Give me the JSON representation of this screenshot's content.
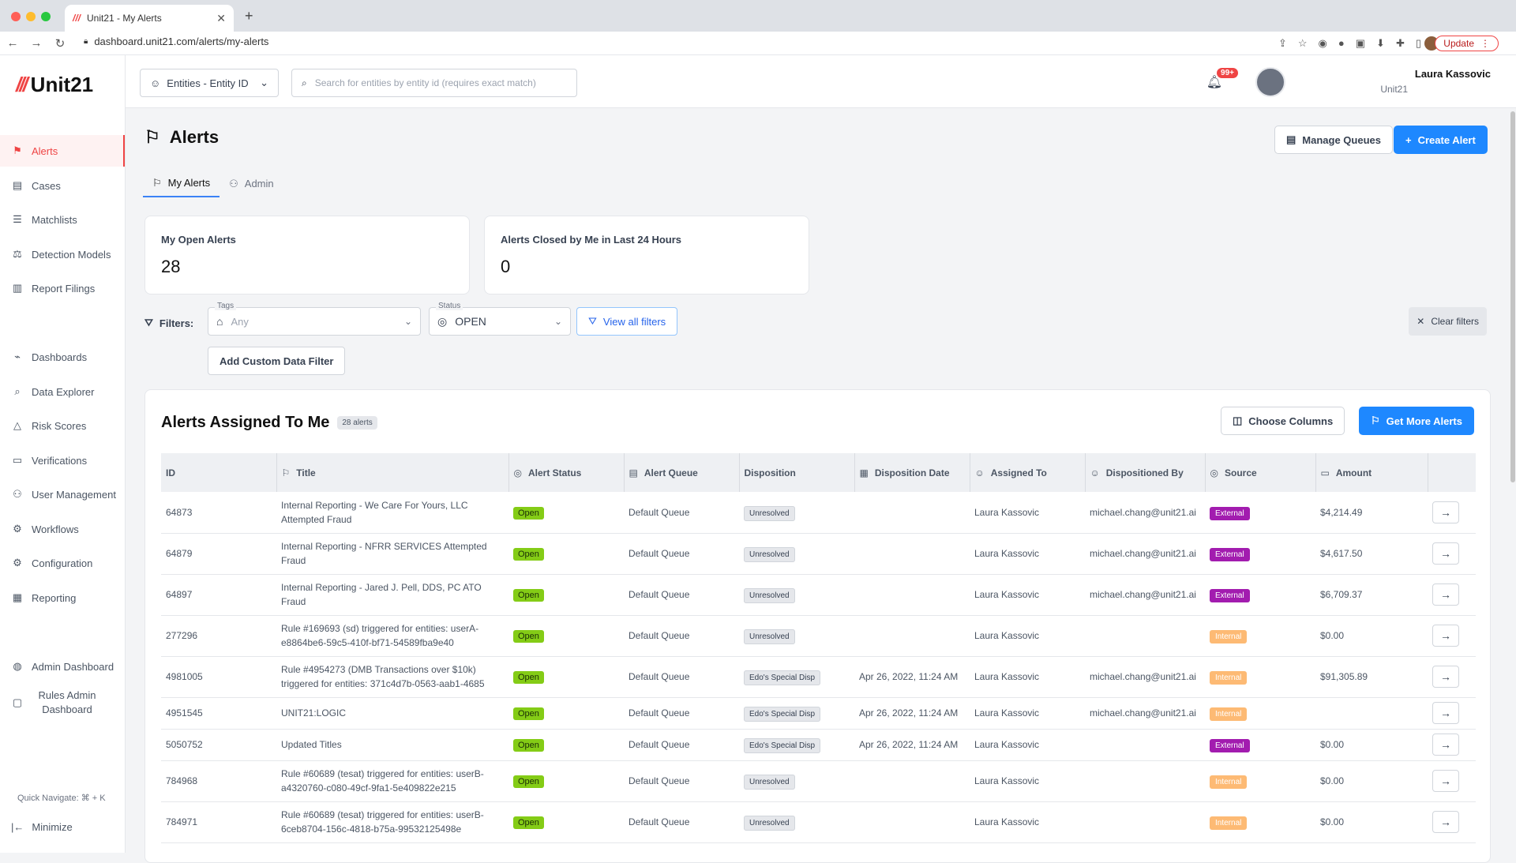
{
  "browser": {
    "tab_title": "Unit21 - My Alerts",
    "url": "dashboard.unit21.com/alerts/my-alerts",
    "update_label": "Update"
  },
  "app": {
    "brand": "Unit21",
    "search_placeholder": "Search for entities by entity id (requires exact match)",
    "entity_selector": "Entities - Entity ID",
    "notifications_badge": "99+",
    "user_name": "Laura Kassovic",
    "user_org": "Unit21"
  },
  "sidebar": {
    "items": [
      {
        "label": "Alerts",
        "icon": "flag-icon"
      },
      {
        "label": "Cases",
        "icon": "briefcase-icon"
      },
      {
        "label": "Matchlists",
        "icon": "user-list-icon"
      },
      {
        "label": "Detection Models",
        "icon": "scale-icon"
      },
      {
        "label": "Report Filings",
        "icon": "building-icon"
      },
      {
        "label": "Dashboards",
        "icon": "chart-icon"
      },
      {
        "label": "Data Explorer",
        "icon": "search-data-icon"
      },
      {
        "label": "Risk Scores",
        "icon": "warning-icon"
      },
      {
        "label": "Verifications",
        "icon": "id-card-icon"
      },
      {
        "label": "User Management",
        "icon": "users-icon"
      },
      {
        "label": "Workflows",
        "icon": "workflow-icon"
      },
      {
        "label": "Configuration",
        "icon": "gear-icon"
      },
      {
        "label": "Reporting",
        "icon": "report-icon"
      },
      {
        "label": "Admin Dashboard",
        "icon": "globe-icon"
      },
      {
        "label": "Rules Admin Dashboard",
        "icon": "clipboard-icon"
      }
    ],
    "quick_navigate": "Quick Navigate: ⌘ + K",
    "minimize": "Minimize"
  },
  "page": {
    "title": "Alerts",
    "manage_queues": "Manage Queues",
    "create_alert": "Create Alert",
    "tabs": [
      "My Alerts",
      "Admin"
    ],
    "stats": [
      {
        "label": "My Open Alerts",
        "value": "28"
      },
      {
        "label": "Alerts Closed by Me in Last 24 Hours",
        "value": "0"
      }
    ],
    "filters": {
      "label": "Filters:",
      "tags_caption": "Tags",
      "tags_value": "Any",
      "status_caption": "Status",
      "status_value": "OPEN",
      "view_all": "View all filters",
      "clear": "Clear filters",
      "add_custom": "Add Custom Data Filter"
    }
  },
  "table": {
    "title": "Alerts Assigned To Me",
    "count": "28 alerts",
    "choose_columns": "Choose Columns",
    "get_more": "Get More Alerts",
    "headers": [
      "ID",
      "Title",
      "Alert Status",
      "Alert Queue",
      "Disposition",
      "Disposition Date",
      "Assigned To",
      "Dispositioned By",
      "Source",
      "Amount"
    ],
    "rows": [
      {
        "id": "64873",
        "title": "Internal Reporting - We Care For Yours, LLC Attempted Fraud",
        "status": "Open",
        "queue": "Default Queue",
        "disposition": "Unresolved",
        "date": "",
        "assigned": "Laura Kassovic",
        "by": "michael.chang@unit21.ai",
        "source": "External",
        "amount": "$4,214.49"
      },
      {
        "id": "64879",
        "title": "Internal Reporting - NFRR SERVICES Attempted Fraud",
        "status": "Open",
        "queue": "Default Queue",
        "disposition": "Unresolved",
        "date": "",
        "assigned": "Laura Kassovic",
        "by": "michael.chang@unit21.ai",
        "source": "External",
        "amount": "$4,617.50"
      },
      {
        "id": "64897",
        "title": "Internal Reporting - Jared J. Pell, DDS, PC ATO Fraud",
        "status": "Open",
        "queue": "Default Queue",
        "disposition": "Unresolved",
        "date": "",
        "assigned": "Laura Kassovic",
        "by": "michael.chang@unit21.ai",
        "source": "External",
        "amount": "$6,709.37"
      },
      {
        "id": "277296",
        "title": "Rule #169693 (sd) triggered for entities: userA-e8864be6-59c5-410f-bf71-54589fba9e40",
        "status": "Open",
        "queue": "Default Queue",
        "disposition": "Unresolved",
        "date": "",
        "assigned": "Laura Kassovic",
        "by": "",
        "source": "Internal",
        "amount": "$0.00"
      },
      {
        "id": "4981005",
        "title": "Rule #4954273 (DMB Transactions over $10k) triggered for entities: 371c4d7b-0563-aab1-4685",
        "status": "Open",
        "queue": "Default Queue",
        "disposition": "Edo's Special Disp",
        "date": "Apr 26, 2022, 11:24 AM",
        "assigned": "Laura Kassovic",
        "by": "michael.chang@unit21.ai",
        "source": "Internal",
        "amount": "$91,305.89"
      },
      {
        "id": "4951545",
        "title": "UNIT21:LOGIC",
        "status": "Open",
        "queue": "Default Queue",
        "disposition": "Edo's Special Disp",
        "date": "Apr 26, 2022, 11:24 AM",
        "assigned": "Laura Kassovic",
        "by": "michael.chang@unit21.ai",
        "source": "Internal",
        "amount": ""
      },
      {
        "id": "5050752",
        "title": "Updated Titles",
        "status": "Open",
        "queue": "Default Queue",
        "disposition": "Edo's Special Disp",
        "date": "Apr 26, 2022, 11:24 AM",
        "assigned": "Laura Kassovic",
        "by": "",
        "source": "External",
        "amount": "$0.00"
      },
      {
        "id": "784968",
        "title": "Rule #60689 (tesat) triggered for entities: userB-a4320760-c080-49cf-9fa1-5e409822e215",
        "status": "Open",
        "queue": "Default Queue",
        "disposition": "Unresolved",
        "date": "",
        "assigned": "Laura Kassovic",
        "by": "",
        "source": "Internal",
        "amount": "$0.00"
      },
      {
        "id": "784971",
        "title": "Rule #60689 (tesat) triggered for entities: userB-6ceb8704-156c-4818-b75a-99532125498e",
        "status": "Open",
        "queue": "Default Queue",
        "disposition": "Unresolved",
        "date": "",
        "assigned": "Laura Kassovic",
        "by": "",
        "source": "Internal",
        "amount": "$0.00"
      }
    ]
  }
}
